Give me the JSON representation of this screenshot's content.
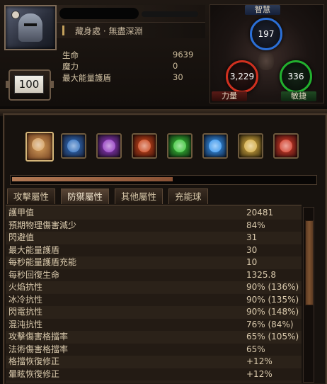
{
  "character": {
    "location": "藏身處 · 無盡深淵",
    "level": "100"
  },
  "resources": [
    {
      "label": "生命",
      "value": "9639"
    },
    {
      "label": "魔力",
      "value": "0"
    },
    {
      "label": "最大能量護盾",
      "value": "30"
    }
  ],
  "attributes": {
    "int": {
      "label": "智慧",
      "value": "197"
    },
    "str": {
      "label": "力量",
      "value": "3,229"
    },
    "dex": {
      "label": "敏捷",
      "value": "336"
    },
    "colors": {
      "int": "#2b6fd6",
      "str": "#d0301f",
      "dex": "#22b02e"
    }
  },
  "skills": [
    {
      "icon": "sword-skill-icon",
      "colors": [
        "#d8a05b",
        "#6b3a1d"
      ],
      "selected": true
    },
    {
      "icon": "blue-slash-skill-icon",
      "colors": [
        "#2f74c9",
        "#1a2038"
      ]
    },
    {
      "icon": "purple-ring-skill-icon",
      "colors": [
        "#9a3bcc",
        "#24122e"
      ]
    },
    {
      "icon": "fire-skill-icon",
      "colors": [
        "#d64a1c",
        "#3a120a"
      ]
    },
    {
      "icon": "green-aura-skill-icon",
      "colors": [
        "#3dd23a",
        "#0f2a11"
      ]
    },
    {
      "icon": "lightning-skill-icon",
      "colors": [
        "#3aa0ff",
        "#0f1f3a"
      ]
    },
    {
      "icon": "golden-rune-skill-icon",
      "colors": [
        "#e0b545",
        "#3a2c0e"
      ]
    },
    {
      "icon": "crimson-orb-skill-icon",
      "colors": [
        "#e0402a",
        "#3a0e0e"
      ]
    }
  ],
  "experience_fraction": 0.53,
  "tabs": [
    {
      "label": "攻擊屬性",
      "active": false
    },
    {
      "label": "防禦屬性",
      "active": true
    },
    {
      "label": "其他屬性",
      "active": false
    },
    {
      "label": "充能球",
      "active": false
    }
  ],
  "defense_stats": [
    {
      "label": "護甲值",
      "value": "20481"
    },
    {
      "label": "預期物理傷害減少",
      "value": "84%"
    },
    {
      "label": "閃避值",
      "value": "31"
    },
    {
      "label": "最大能量護盾",
      "value": "30"
    },
    {
      "label": "每秒能量護盾充能",
      "value": "10"
    },
    {
      "label": "每秒回復生命",
      "value": "1325.8"
    },
    {
      "label": "火焰抗性",
      "value": "90% (136%)"
    },
    {
      "label": "冰冷抗性",
      "value": "90% (135%)"
    },
    {
      "label": "閃電抗性",
      "value": "90% (148%)"
    },
    {
      "label": "混沌抗性",
      "value": "76% (84%)"
    },
    {
      "label": "攻擊傷害格擋率",
      "value": "65% (105%)"
    },
    {
      "label": "法術傷害格擋率",
      "value": "65%"
    },
    {
      "label": "格擋恢復修正",
      "value": "+12%"
    },
    {
      "label": "暈眩恢復修正",
      "value": "+12%"
    }
  ]
}
